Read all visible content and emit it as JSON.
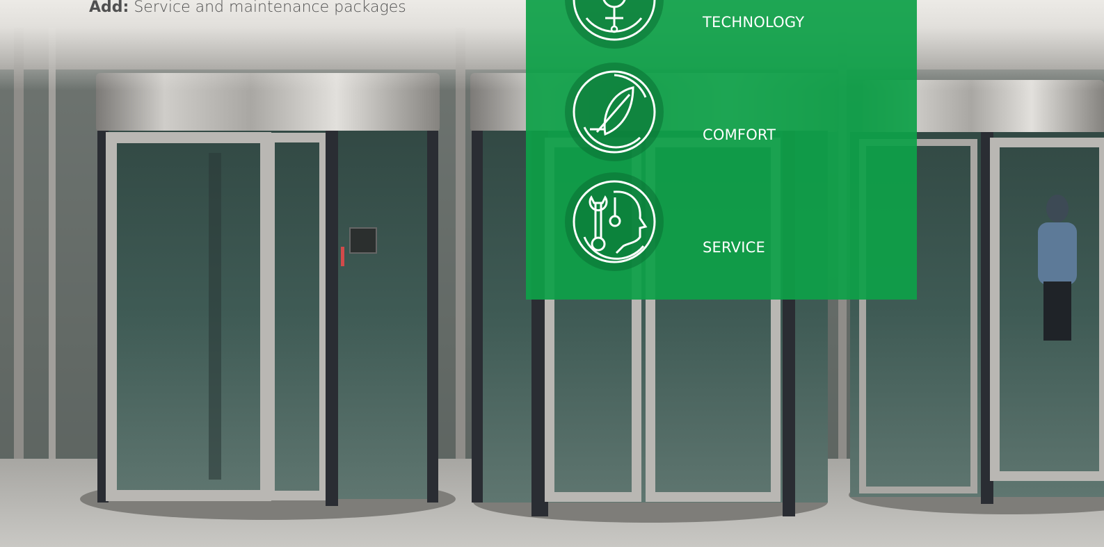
{
  "header": {
    "add_prefix": "Add:",
    "add_text": "Service and maintenance packages"
  },
  "features": [
    {
      "label": "TECHNOLOGY",
      "icon": "gear-icon"
    },
    {
      "label": "COMFORT",
      "icon": "feather-icon"
    },
    {
      "label": "SERVICE",
      "icon": "wrench-head-icon"
    }
  ],
  "colors": {
    "panel_green": "#0ea048",
    "text_on_green": "#ffffff"
  },
  "background": {
    "description_icon": "revolving-door-photo"
  }
}
